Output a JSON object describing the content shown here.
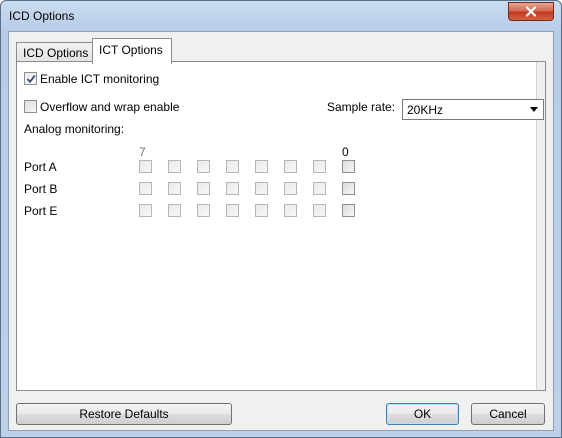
{
  "window": {
    "title": "ICD Options"
  },
  "tabs": [
    {
      "label": "ICD Options"
    },
    {
      "label": "ICT Options"
    }
  ],
  "ict": {
    "enable_monitoring": {
      "label": "Enable ICT monitoring",
      "checked": true
    },
    "overflow_wrap": {
      "label": "Overflow and wrap enable",
      "checked": false
    },
    "sample_rate": {
      "label": "Sample rate:",
      "value": "20KHz"
    },
    "analog_monitoring": {
      "label": "Analog monitoring:",
      "bit_high": "7",
      "bit_low": "0",
      "ports": [
        {
          "label": "Port A"
        },
        {
          "label": "Port B"
        },
        {
          "label": "Port E"
        }
      ]
    }
  },
  "buttons": {
    "restore_defaults": "Restore Defaults",
    "ok": "OK",
    "cancel": "Cancel"
  },
  "icons": {
    "close": "close-icon",
    "check": "check-icon",
    "dropdown": "chevron-down-icon"
  }
}
